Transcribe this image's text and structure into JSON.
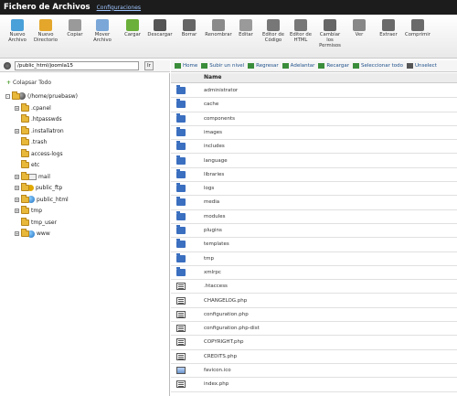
{
  "window": {
    "title": "Fichero de Archivos",
    "config_link": "Configuraciones"
  },
  "toolbar": {
    "buttons": [
      {
        "label": "Nuevo Archivo",
        "icon": "new-file-icon"
      },
      {
        "label": "Nuevo Directorio",
        "icon": "new-folder-icon"
      },
      {
        "label": "Copiar",
        "icon": "copy-icon"
      },
      {
        "label": "Mover Archivo",
        "icon": "move-icon"
      },
      {
        "label": "Cargar",
        "icon": "upload-icon"
      },
      {
        "label": "Descargar",
        "icon": "download-icon"
      },
      {
        "label": "Borrar",
        "icon": "delete-icon"
      },
      {
        "label": "Renombrar",
        "icon": "rename-icon"
      },
      {
        "label": "Editar",
        "icon": "edit-icon"
      },
      {
        "label": "Editor de Código",
        "icon": "code-editor-icon"
      },
      {
        "label": "Editor de HTML",
        "icon": "html-editor-icon"
      },
      {
        "label": "Cambiar los Permisos",
        "icon": "permissions-icon"
      },
      {
        "label": "Ver",
        "icon": "view-icon"
      },
      {
        "label": "Extraer",
        "icon": "extract-icon"
      },
      {
        "label": "Comprimir",
        "icon": "compress-icon"
      }
    ]
  },
  "path": {
    "value": "/public_html/joomla15",
    "go_label": "Ir"
  },
  "tree": {
    "collapse_label": "Colapsar Todo",
    "root_label": "(/home/pruebasw)",
    "items": [
      {
        "label": ".cpanel",
        "type": "folder",
        "expandable": true
      },
      {
        "label": ".htpasswds",
        "type": "folder",
        "expandable": false
      },
      {
        "label": ".installatron",
        "type": "folder",
        "expandable": true
      },
      {
        "label": ".trash",
        "type": "folder",
        "expandable": false
      },
      {
        "label": "access-logs",
        "type": "folder",
        "expandable": false
      },
      {
        "label": "etc",
        "type": "folder",
        "expandable": false
      },
      {
        "label": "mail",
        "type": "mail",
        "expandable": true
      },
      {
        "label": "public_ftp",
        "type": "ftp",
        "expandable": true
      },
      {
        "label": "public_html",
        "type": "web",
        "expandable": true
      },
      {
        "label": "tmp",
        "type": "folder",
        "expandable": true
      },
      {
        "label": "tmp_user",
        "type": "folder",
        "expandable": false
      },
      {
        "label": "www",
        "type": "web",
        "expandable": true
      }
    ]
  },
  "actions": [
    {
      "label": "Home",
      "icon": "home-icon"
    },
    {
      "label": "Subir un nivel",
      "icon": "up-level-icon"
    },
    {
      "label": "Regresar",
      "icon": "back-icon"
    },
    {
      "label": "Adelantar",
      "icon": "forward-icon"
    },
    {
      "label": "Recargar",
      "icon": "reload-icon"
    },
    {
      "label": "Seleccionar todo",
      "icon": "select-all-icon"
    },
    {
      "label": "Unselect",
      "icon": "unselect-icon"
    }
  ],
  "list": {
    "column_name": "Name",
    "files": [
      {
        "name": "administrator",
        "type": "folder"
      },
      {
        "name": "cache",
        "type": "folder"
      },
      {
        "name": "components",
        "type": "folder"
      },
      {
        "name": "images",
        "type": "folder"
      },
      {
        "name": "includes",
        "type": "folder"
      },
      {
        "name": "language",
        "type": "folder"
      },
      {
        "name": "libraries",
        "type": "folder"
      },
      {
        "name": "logs",
        "type": "folder"
      },
      {
        "name": "media",
        "type": "folder"
      },
      {
        "name": "modules",
        "type": "folder"
      },
      {
        "name": "plugins",
        "type": "folder"
      },
      {
        "name": "templates",
        "type": "folder"
      },
      {
        "name": "tmp",
        "type": "folder"
      },
      {
        "name": "xmlrpc",
        "type": "folder"
      },
      {
        "name": ".htaccess",
        "type": "file"
      },
      {
        "name": "CHANGELOG.php",
        "type": "file"
      },
      {
        "name": "configuration.php",
        "type": "file"
      },
      {
        "name": "configuration.php-dist",
        "type": "file"
      },
      {
        "name": "COPYRIGHT.php",
        "type": "file"
      },
      {
        "name": "CREDITS.php",
        "type": "file"
      },
      {
        "name": "favicon.ico",
        "type": "img"
      },
      {
        "name": "index.php",
        "type": "file"
      }
    ]
  }
}
